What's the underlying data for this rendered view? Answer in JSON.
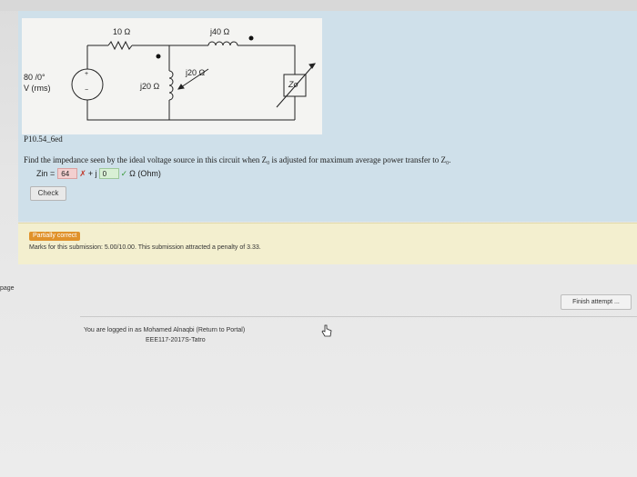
{
  "circuit": {
    "r1": "10 Ω",
    "l1": "j40 Ω",
    "l2": "j20 Ω",
    "l3": "j20 Ω",
    "source_value": "80 /0°",
    "source_unit": "V (rms)",
    "source_plus": "+",
    "source_minus": "−",
    "load": "Zo"
  },
  "question": {
    "id": "P10.54_6ed",
    "text": "Find the impedance seen by the ideal voltage source in this circuit when Z₀ is adjusted for maximum average power transfer to Z₀.",
    "zin_label": "Zin =",
    "real_value": "64",
    "plus_j": "+ j",
    "imag_value": "0",
    "unit": "Ω (Ohm)",
    "check_label": "Check"
  },
  "feedback": {
    "badge": "Partially correct",
    "marks_text": "Marks for this submission: 5.00/10.00. This submission attracted a penalty of 3.33."
  },
  "nav": {
    "page_label": "page",
    "finish_label": "Finish attempt ..."
  },
  "footer": {
    "login_text": "You are logged in as Mohamed Alnaqbi (Return to Portal)",
    "course": "EEE117-2017S-Tatro"
  },
  "colors": {
    "panel": "#cfe0ea",
    "feedback": "#f3efcf",
    "badge": "#e0922b"
  }
}
